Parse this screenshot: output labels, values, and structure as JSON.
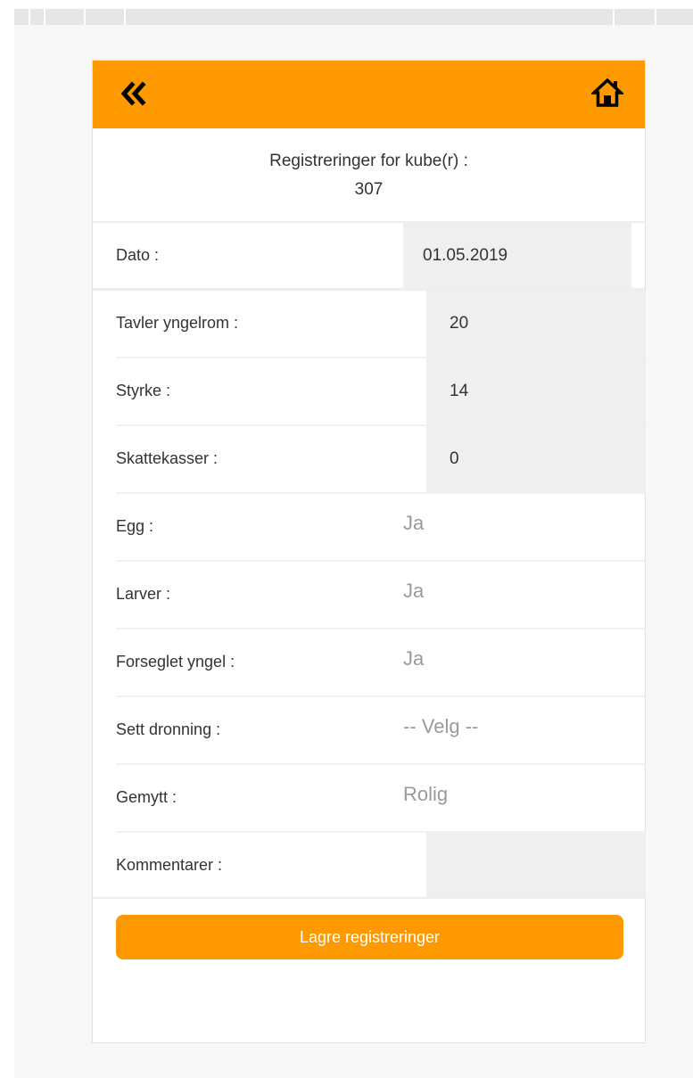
{
  "header": {
    "title": "Registreringer for kube(r) :",
    "kube_number": "307"
  },
  "icons": {
    "back": "double-chevron-left-icon",
    "home": "home-icon"
  },
  "colors": {
    "accent": "#ff9900",
    "field_bg": "#efefef",
    "placeholder": "#9a9a9a"
  },
  "form": {
    "dato": {
      "label": "Dato :",
      "value": "01.05.2019"
    },
    "tavler": {
      "label": "Tavler yngelrom :",
      "value": "20"
    },
    "styrke": {
      "label": "Styrke :",
      "value": "14"
    },
    "skattekasser": {
      "label": "Skattekasser :",
      "value": "0"
    },
    "egg": {
      "label": "Egg :",
      "value": "Ja"
    },
    "larver": {
      "label": "Larver :",
      "value": "Ja"
    },
    "forseglet": {
      "label": "Forseglet yngel :",
      "value": "Ja"
    },
    "dronning": {
      "label": "Sett dronning :",
      "value": "-- Velg --"
    },
    "gemytt": {
      "label": "Gemytt :",
      "value": "Rolig"
    },
    "kommentarer": {
      "label": "Kommentarer :",
      "value": ""
    }
  },
  "actions": {
    "save_label": "Lagre registreringer"
  }
}
